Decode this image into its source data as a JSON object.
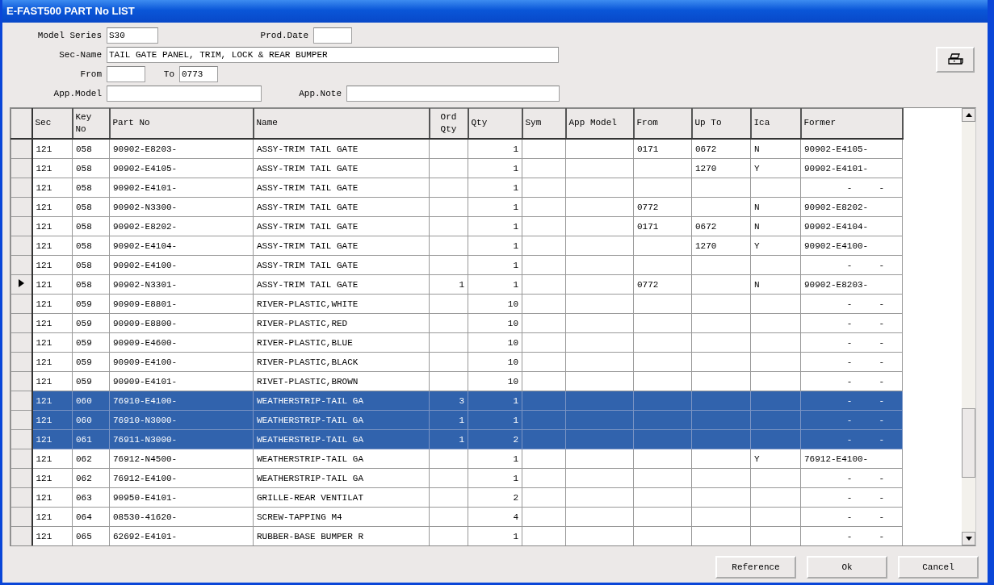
{
  "window": {
    "title": "E-FAST500 PART No LIST"
  },
  "filters": {
    "model_series": {
      "label": "Model Series",
      "value": "S30"
    },
    "prod_date": {
      "label": "Prod.Date"
    },
    "sec_name": {
      "label": "Sec-Name",
      "value": "TAIL GATE PANEL, TRIM, LOCK & REAR BUMPER"
    },
    "from": {
      "label": "From"
    },
    "to": {
      "label": "To",
      "value": "0773"
    },
    "app_model": {
      "label": "App.Model"
    },
    "app_note": {
      "label": "App.Note"
    }
  },
  "table": {
    "columns": [
      "Sec",
      "Key No",
      "Part No",
      "Name",
      "Ord Qty",
      "Qty",
      "Sym",
      "App Model",
      "From",
      "Up To",
      "Ica",
      "Former"
    ],
    "rows": [
      {
        "selected": false,
        "current": false,
        "sec": "121",
        "key_no": "058",
        "part_no": "90902-E8203-",
        "name": "ASSY-TRIM TAIL GATE",
        "qty": "1",
        "from": "0171",
        "up_to": "0672",
        "ica": "N",
        "former": "90902-E4105-"
      },
      {
        "selected": false,
        "current": false,
        "sec": "121",
        "key_no": "058",
        "part_no": "90902-E4105-",
        "name": "ASSY-TRIM TAIL GATE",
        "qty": "1",
        "up_to": "1270",
        "ica": "Y",
        "former": "90902-E4101-"
      },
      {
        "selected": false,
        "current": false,
        "sec": "121",
        "key_no": "058",
        "part_no": "90902-E4101-",
        "name": "ASSY-TRIM TAIL GATE",
        "qty": "1",
        "former": "        -     -"
      },
      {
        "selected": false,
        "current": false,
        "sec": "121",
        "key_no": "058",
        "part_no": "90902-N3300-",
        "name": "ASSY-TRIM TAIL GATE",
        "qty": "1",
        "from": "0772",
        "ica": "N",
        "former": "90902-E8202-"
      },
      {
        "selected": false,
        "current": false,
        "sec": "121",
        "key_no": "058",
        "part_no": "90902-E8202-",
        "name": "ASSY-TRIM TAIL GATE",
        "qty": "1",
        "from": "0171",
        "up_to": "0672",
        "ica": "N",
        "former": "90902-E4104-"
      },
      {
        "selected": false,
        "current": false,
        "sec": "121",
        "key_no": "058",
        "part_no": "90902-E4104-",
        "name": "ASSY-TRIM TAIL GATE",
        "qty": "1",
        "up_to": "1270",
        "ica": "Y",
        "former": "90902-E4100-"
      },
      {
        "selected": false,
        "current": false,
        "sec": "121",
        "key_no": "058",
        "part_no": "90902-E4100-",
        "name": "ASSY-TRIM TAIL GATE",
        "qty": "1",
        "former": "        -     -"
      },
      {
        "selected": false,
        "current": true,
        "sec": "121",
        "key_no": "058",
        "part_no": "90902-N3301-",
        "name": "ASSY-TRIM TAIL GATE",
        "ord_qty": "1",
        "qty": "1",
        "from": "0772",
        "ica": "N",
        "former": "90902-E8203-"
      },
      {
        "selected": false,
        "current": false,
        "sec": "121",
        "key_no": "059",
        "part_no": "90909-E8801-",
        "name": "RIVER-PLASTIC,WHITE",
        "qty": "10",
        "former": "        -     -"
      },
      {
        "selected": false,
        "current": false,
        "sec": "121",
        "key_no": "059",
        "part_no": "90909-E8800-",
        "name": "RIVER-PLASTIC,RED",
        "qty": "10",
        "former": "        -     -"
      },
      {
        "selected": false,
        "current": false,
        "sec": "121",
        "key_no": "059",
        "part_no": "90909-E4600-",
        "name": "RIVER-PLASTIC,BLUE",
        "qty": "10",
        "former": "        -     -"
      },
      {
        "selected": false,
        "current": false,
        "sec": "121",
        "key_no": "059",
        "part_no": "90909-E4100-",
        "name": "RIVER-PLASTIC,BLACK",
        "qty": "10",
        "former": "        -     -"
      },
      {
        "selected": false,
        "current": false,
        "sec": "121",
        "key_no": "059",
        "part_no": "90909-E4101-",
        "name": "RIVET-PLASTIC,BROWN",
        "qty": "10",
        "former": "        -     -"
      },
      {
        "selected": true,
        "current": false,
        "sec": "121",
        "key_no": "060",
        "part_no": "76910-E4100-",
        "name": "WEATHERSTRIP-TAIL GA",
        "ord_qty": "3",
        "qty": "1",
        "former": "        -     -"
      },
      {
        "selected": true,
        "current": false,
        "sec": "121",
        "key_no": "060",
        "part_no": "76910-N3000-",
        "name": "WEATHERSTRIP-TAIL GA",
        "ord_qty": "1",
        "qty": "1",
        "former": "        -     -"
      },
      {
        "selected": true,
        "current": false,
        "sec": "121",
        "key_no": "061",
        "part_no": "76911-N3000-",
        "name": "WEATHERSTRIP-TAIL GA",
        "ord_qty": "1",
        "qty": "2",
        "former": "        -     -"
      },
      {
        "selected": false,
        "current": false,
        "sec": "121",
        "key_no": "062",
        "part_no": "76912-N4500-",
        "name": "WEATHERSTRIP-TAIL GA",
        "qty": "1",
        "ica": "Y",
        "former": "76912-E4100-"
      },
      {
        "selected": false,
        "current": false,
        "sec": "121",
        "key_no": "062",
        "part_no": "76912-E4100-",
        "name": "WEATHERSTRIP-TAIL GA",
        "qty": "1",
        "former": "        -     -"
      },
      {
        "selected": false,
        "current": false,
        "sec": "121",
        "key_no": "063",
        "part_no": "90950-E4101-",
        "name": "GRILLE-REAR VENTILAT",
        "qty": "2",
        "former": "        -     -"
      },
      {
        "selected": false,
        "current": false,
        "sec": "121",
        "key_no": "064",
        "part_no": "08530-41620-",
        "name": "SCREW-TAPPING M4",
        "qty": "4",
        "former": "        -     -"
      },
      {
        "selected": false,
        "current": false,
        "sec": "121",
        "key_no": "065",
        "part_no": "62692-E4101-",
        "name": "RUBBER-BASE BUMPER R",
        "qty": "1",
        "former": "        -     -"
      }
    ]
  },
  "buttons": [
    "Reference",
    "Ok",
    "Cancel"
  ]
}
